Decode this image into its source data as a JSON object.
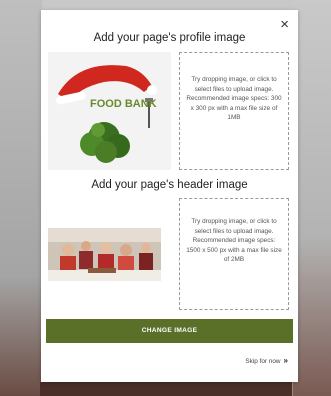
{
  "modal": {
    "close_glyph": "×",
    "profile": {
      "title": "Add your page's profile image",
      "dropzone_text": "Try dropping image, or click to select files to upload image. Recommended image specs: 300 x 300 px with a max file size of 1MB",
      "image_text": "FOOD BANK"
    },
    "header": {
      "title": "Add your page's header image",
      "dropzone_text": "Try dropping image, or click to select files to upload image. Recommended image specs: 1500 x 500 px with a max file size of 2MB"
    },
    "change_button": "CHANGE IMAGE",
    "skip_label": "Skip for now",
    "skip_arrow": "»"
  },
  "colors": {
    "button": "#5a7028",
    "overlay": "#bdbdbd"
  }
}
